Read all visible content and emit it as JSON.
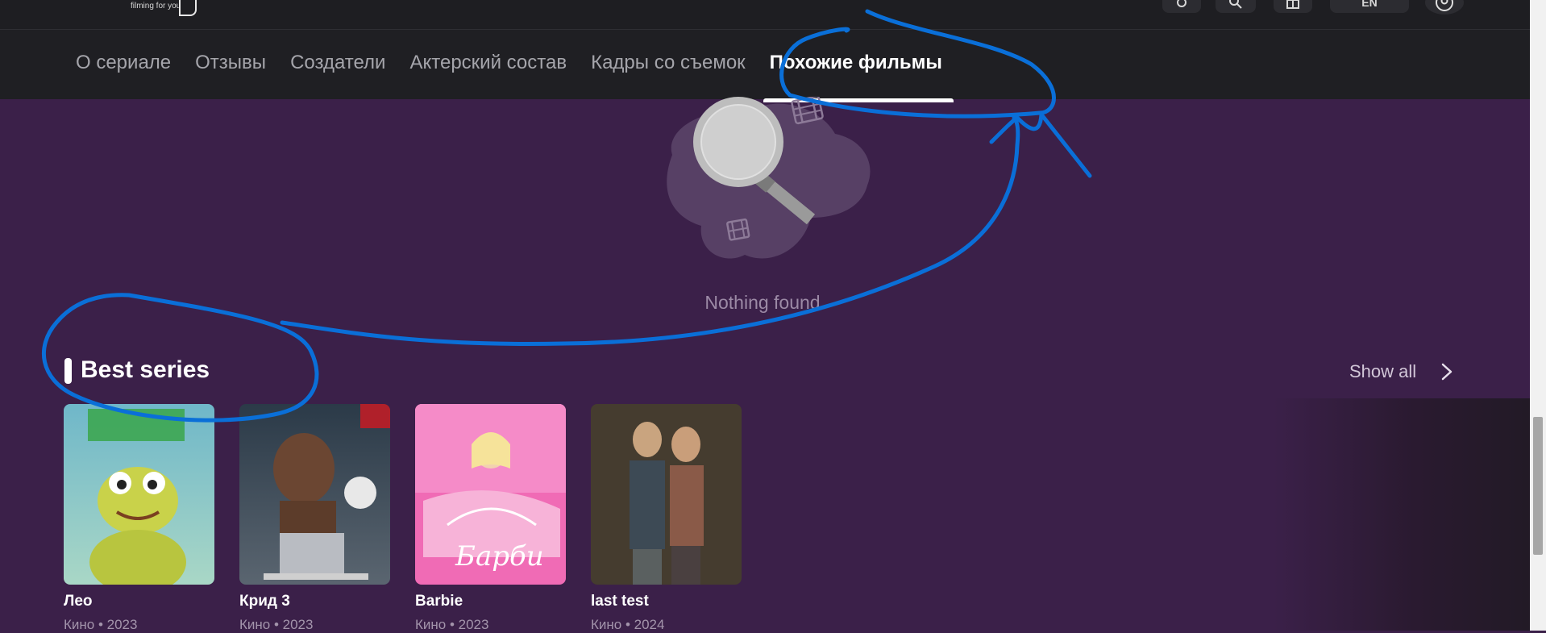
{
  "header": {
    "logo_tagline": "filming for you",
    "language": "EN",
    "icons": [
      "gift-like-icon",
      "search-icon",
      "gift-icon",
      "user-icon"
    ]
  },
  "tabs": [
    {
      "label": "О сериале",
      "active": false
    },
    {
      "label": "Отзывы",
      "active": false
    },
    {
      "label": "Создатели",
      "active": false
    },
    {
      "label": "Актерский состав",
      "active": false
    },
    {
      "label": "Кадры со съемок",
      "active": false
    },
    {
      "label": "Похожие фильмы",
      "active": true
    }
  ],
  "empty_state": {
    "message": "Nothing found",
    "illustration": "magnifier-film-icon"
  },
  "section": {
    "title": "Best series",
    "show_all": "Show all"
  },
  "cards": [
    {
      "title": "Лео",
      "meta": "Кино • 2023"
    },
    {
      "title": "Крид 3",
      "meta": "Кино • 2023"
    },
    {
      "title": "Barbie",
      "meta": "Кино • 2023"
    },
    {
      "title": "last test",
      "meta": "Кино • 2024"
    }
  ],
  "colors": {
    "background": "#3b2049",
    "nav_background": "#1f1f23",
    "annotation": "#0a6fd8"
  }
}
